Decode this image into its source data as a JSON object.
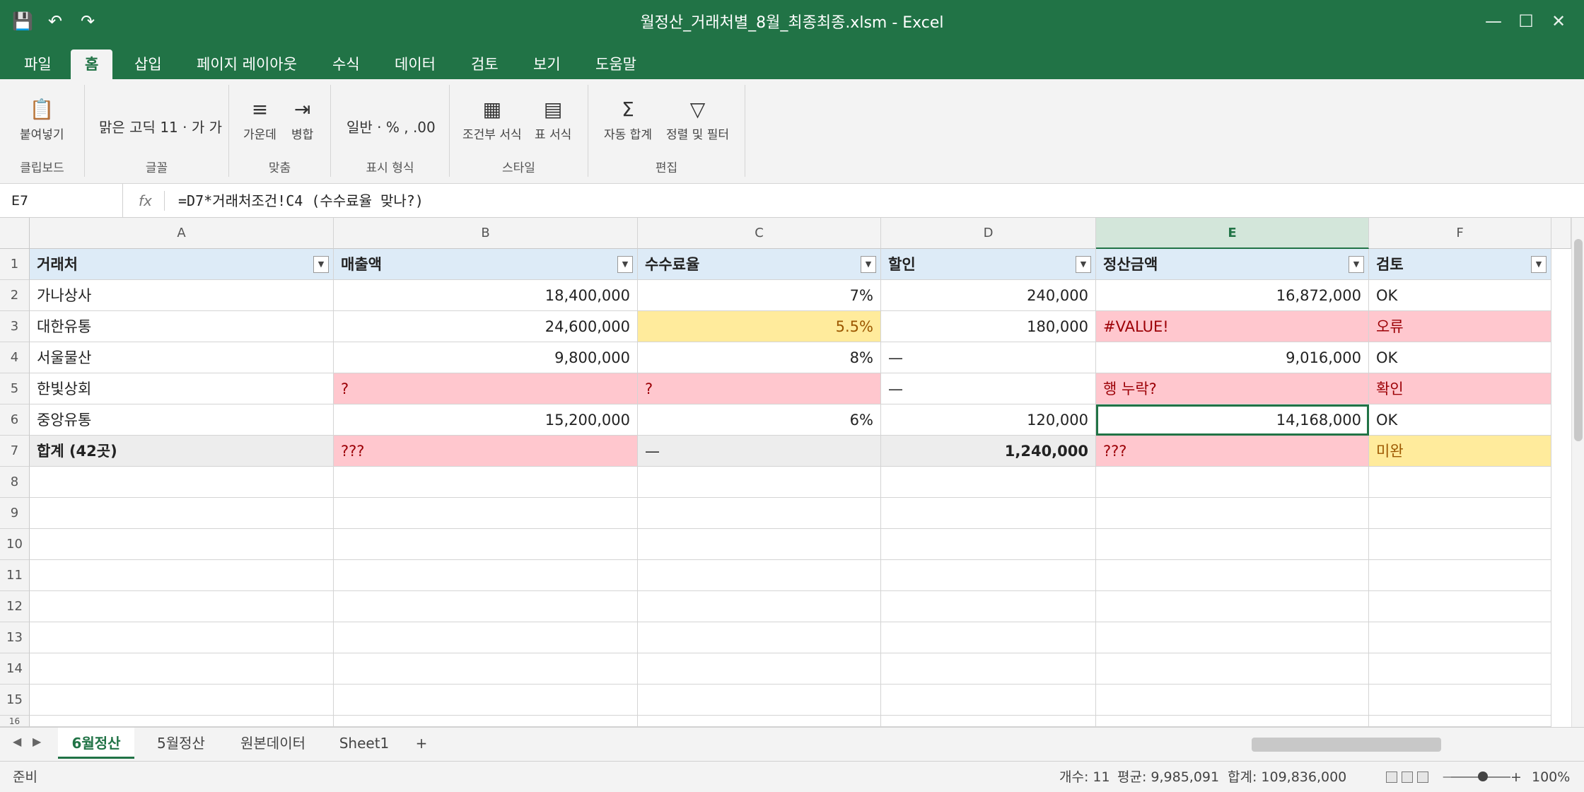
{
  "window": {
    "title": "월정산_거래처별_8월_최종최종.xlsm - Excel",
    "qat_icons": [
      "save-icon",
      "undo-icon",
      "redo-icon"
    ],
    "controls": [
      "minimize-icon",
      "maximize-icon",
      "close-icon"
    ],
    "theme_color": "#217346"
  },
  "ribbon": {
    "tabs": [
      {
        "label": "파일",
        "active": false
      },
      {
        "label": "홈",
        "active": true
      },
      {
        "label": "삽입",
        "active": false
      },
      {
        "label": "페이지 레이아웃",
        "active": false
      },
      {
        "label": "수식",
        "active": false
      },
      {
        "label": "데이터",
        "active": false
      },
      {
        "label": "검토",
        "active": false
      },
      {
        "label": "보기",
        "active": false
      },
      {
        "label": "도움말",
        "active": false
      }
    ],
    "groups": {
      "clipboard": {
        "name": "클립보드",
        "paste_label": "붙여넣기"
      },
      "font": {
        "name": "글꼴",
        "text": "맑은 고딕 11 · 가 가"
      },
      "align": {
        "name": "맞춤",
        "center_label": "가운데",
        "merge_label": "병합"
      },
      "number": {
        "name": "표시 형식",
        "text": "일반 · % , .00"
      },
      "styles": {
        "name": "스타일",
        "cond_label": "조건부 서식",
        "table_label": "표 서식"
      },
      "editing": {
        "name": "편집",
        "autosum_label": "자동 합계",
        "sort_label": "정렬 및 필터"
      }
    }
  },
  "formula_bar": {
    "name_box": "E7",
    "fx": "fx",
    "formula": "=D7*거래처조건!C4 (수수료율 맞나?)"
  },
  "grid": {
    "columns": [
      "A",
      "B",
      "C",
      "D",
      "E",
      "F"
    ],
    "selected_column": "E",
    "row_numbers": [
      "1",
      "2",
      "3",
      "4",
      "5",
      "6",
      "7",
      "8",
      "9",
      "10",
      "11",
      "12",
      "13",
      "14",
      "15",
      "16"
    ],
    "header_row": [
      "거래처",
      "매출액",
      "수수료율",
      "할인",
      "정산금액",
      "검토"
    ],
    "rows": [
      [
        "가나상사",
        "18,400,000",
        "7%",
        "240,000",
        "16,872,000",
        "OK"
      ],
      [
        "대한유통",
        "24,600,000",
        "5.5%",
        "180,000",
        "#VALUE!",
        "오류"
      ],
      [
        "서울물산",
        "9,800,000",
        "8%",
        "—",
        "9,016,000",
        "OK"
      ],
      [
        "한빛상회",
        "?",
        "?",
        "—",
        "행 누락?",
        "확인"
      ],
      [
        "중앙유통",
        "15,200,000",
        "6%",
        "120,000",
        "14,168,000",
        "OK"
      ],
      [
        "합계 (42곳)",
        "???",
        "—",
        "1,240,000",
        "???",
        "미완"
      ]
    ],
    "active_cell": "E6",
    "colors": {
      "header_fill": "#ddebf7",
      "error_fill": "#ffc7ce",
      "error_text": "#9c0006",
      "warn_fill": "#ffeb9c",
      "warn_text": "#9c5700",
      "total_fill": "#ededed"
    }
  },
  "sheets": {
    "tabs": [
      {
        "label": "6월정산",
        "active": true
      },
      {
        "label": "5월정산",
        "active": false
      },
      {
        "label": "원본데이터",
        "active": false
      },
      {
        "label": "Sheet1",
        "active": false
      }
    ],
    "add_label": "+"
  },
  "status": {
    "ready": "준비",
    "count": "개수: 11",
    "average": "평균: 9,985,091",
    "sum": "합계: 109,836,000",
    "zoom_minus": "—",
    "zoom_plus": "+",
    "zoom": "100%"
  }
}
